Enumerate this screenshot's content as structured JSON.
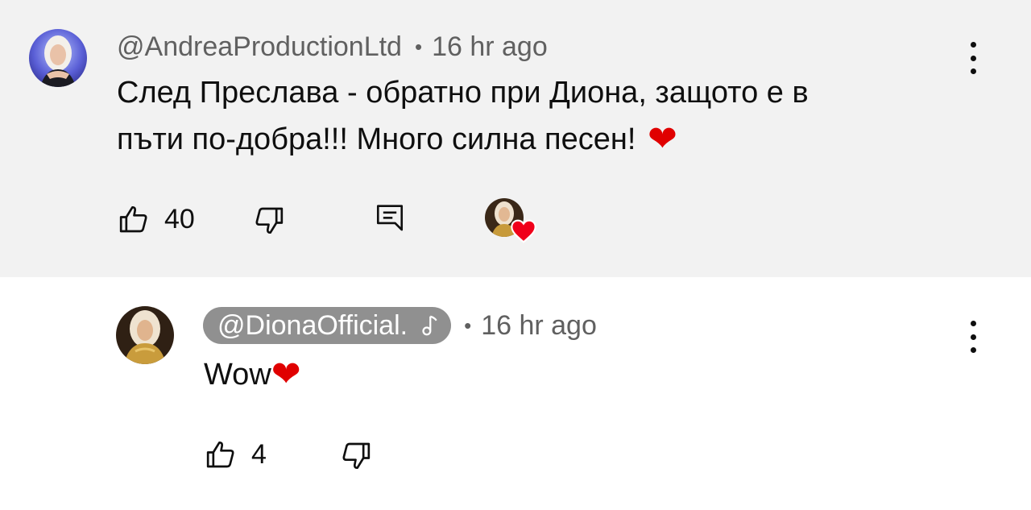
{
  "comments": [
    {
      "author": "@AndreaProductionLtd",
      "separator": "•",
      "time": "16 hr ago",
      "text_line1": "След Преслава - обратно при Диона, защото е в",
      "text_line2": "пъти по-добра!!! Много силна песен! ",
      "emoji": "❤",
      "like_count": "40",
      "has_creator_heart": true
    },
    {
      "author": "@DionaOfficial.",
      "author_badge_icon": "music-note-icon",
      "separator": "•",
      "time": "16 hr ago",
      "text": "Wow",
      "emoji": "❤",
      "like_count": "4"
    }
  ],
  "colors": {
    "highlight_background": "#f2f2f2",
    "author_chip": "#909090",
    "heart": "#e00000",
    "meta_text": "#606060"
  },
  "icons": [
    "thumb-up-icon",
    "thumb-down-icon",
    "reply-icon",
    "more-vert-icon",
    "music-note-icon",
    "heart-icon"
  ]
}
